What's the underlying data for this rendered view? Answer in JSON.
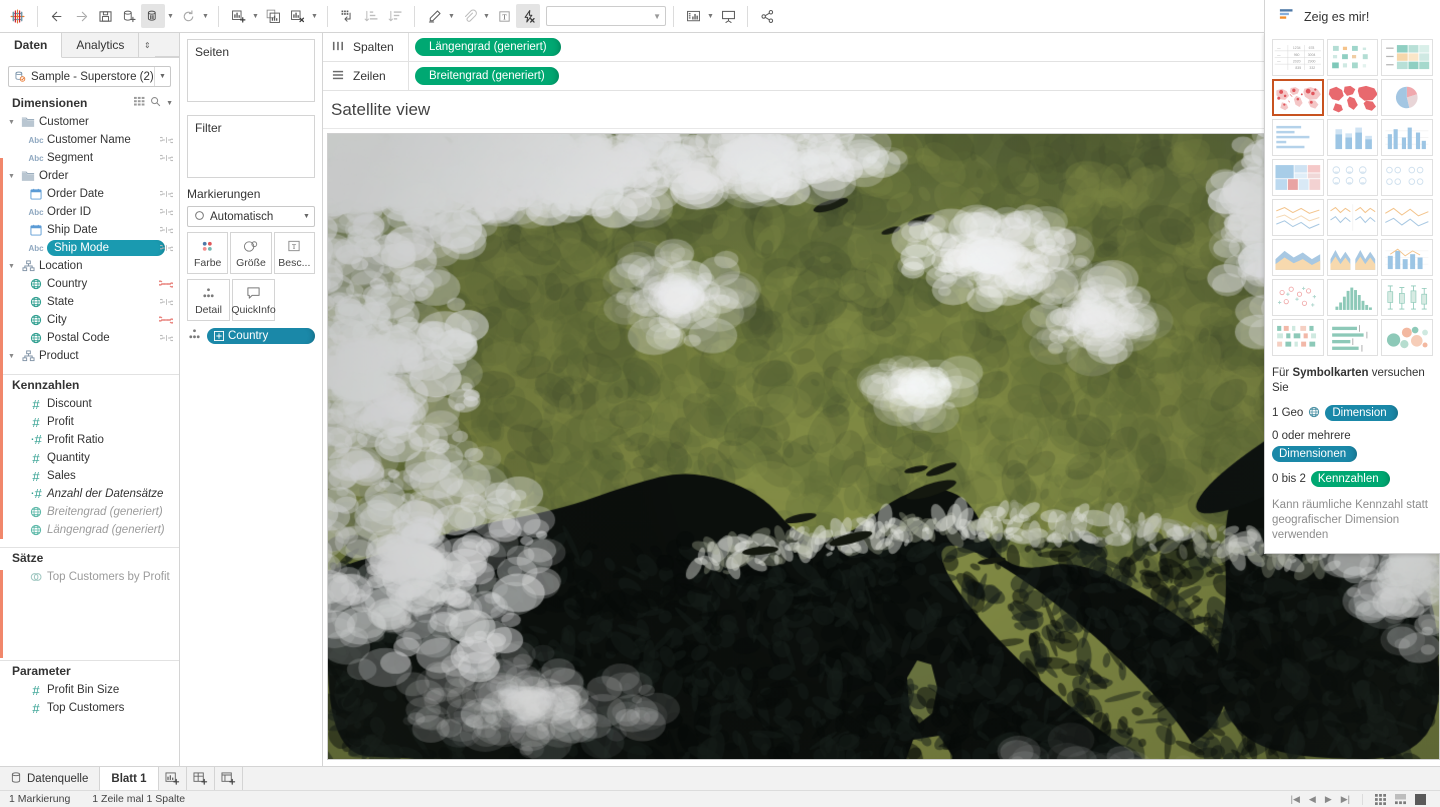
{
  "toolbar": {
    "logo_icon": "tableau-logo-icon",
    "buttons": [
      {
        "name": "back-button",
        "icon": "arrow-left-icon"
      },
      {
        "name": "forward-button",
        "icon": "arrow-right-icon"
      },
      {
        "name": "save-button",
        "icon": "save-icon"
      },
      {
        "name": "new-data-source-button",
        "icon": "database-plus-icon"
      },
      {
        "name": "pause-auto-update-button",
        "icon": "database-pause-icon"
      },
      {
        "name": "refresh-button",
        "icon": "refresh-icon"
      },
      {
        "name": "new-worksheet-button",
        "icon": "chart-plus-icon"
      },
      {
        "name": "duplicate-sheet-button",
        "icon": "chart-duplicate-icon"
      },
      {
        "name": "clear-sheet-button",
        "icon": "chart-clear-icon"
      },
      {
        "name": "swap-rows-columns-button",
        "icon": "swap-axes-icon"
      },
      {
        "name": "sort-ascending-button",
        "icon": "sort-asc-icon"
      },
      {
        "name": "sort-descending-button",
        "icon": "sort-desc-icon"
      },
      {
        "name": "highlight-button",
        "icon": "highlighter-icon"
      },
      {
        "name": "group-members-button",
        "icon": "paperclip-icon"
      },
      {
        "name": "show-mark-labels-button",
        "icon": "text-label-icon"
      },
      {
        "name": "fix-axes-button",
        "icon": "magic-clear-icon"
      },
      {
        "name": "presentation-size-button",
        "icon": "fit-size-icon"
      },
      {
        "name": "presentation-mode-button",
        "icon": "presentation-icon"
      },
      {
        "name": "share-button",
        "icon": "share-icon"
      }
    ],
    "fit_combo_value": "",
    "show_me_label": "Zeig es mir!",
    "show_me_icon": "show-me-icon"
  },
  "datapane": {
    "tabs": [
      {
        "label": "Daten",
        "selected": true
      },
      {
        "label": "Analytics",
        "selected": false
      }
    ],
    "datasource": {
      "name": "Sample - Superstore (2)",
      "icon": "datasource-icon",
      "caret": "chevron-down-icon"
    },
    "dimensions": {
      "header": "Dimensionen",
      "tools": [
        "grid-view-icon",
        "search-icon",
        "chevron-down-icon"
      ],
      "items": [
        {
          "label": "Customer",
          "icon": "folder-icon",
          "level": 0,
          "twist": "expanded"
        },
        {
          "label": "Customer Name",
          "icon": "abc-icon",
          "level": 1,
          "right": "link-icon"
        },
        {
          "label": "Segment",
          "icon": "abc-icon",
          "level": 1,
          "right": "link-icon"
        },
        {
          "label": "Order",
          "icon": "folder-icon",
          "level": 0,
          "twist": "expanded"
        },
        {
          "label": "Order Date",
          "icon": "calendar-icon",
          "level": 1,
          "right": "link-icon"
        },
        {
          "label": "Order ID",
          "icon": "abc-icon",
          "level": 1,
          "right": "link-icon"
        },
        {
          "label": "Ship Date",
          "icon": "calendar-icon",
          "level": 1,
          "right": "link-icon"
        },
        {
          "label": "Ship Mode",
          "icon": "abc-icon",
          "level": 1,
          "right": "link-icon",
          "selected": true
        },
        {
          "label": "Location",
          "icon": "hierarchy-icon",
          "level": 0,
          "twist": "expanded"
        },
        {
          "label": "Country",
          "icon": "globe-icon",
          "level": 1,
          "right": "link-active-icon"
        },
        {
          "label": "State",
          "icon": "globe-icon",
          "level": 1,
          "right": "link-icon"
        },
        {
          "label": "City",
          "icon": "globe-icon",
          "level": 1,
          "right": "link-active-icon"
        },
        {
          "label": "Postal Code",
          "icon": "globe-icon",
          "level": 1,
          "right": "link-icon"
        },
        {
          "label": "Product",
          "icon": "hierarchy-icon",
          "level": 0,
          "twist": "expanded"
        }
      ]
    },
    "measures": {
      "header": "Kennzahlen",
      "items": [
        {
          "label": "Discount",
          "icon": "hash-icon"
        },
        {
          "label": "Profit",
          "icon": "hash-icon"
        },
        {
          "label": "Profit Ratio",
          "icon": "hash-calc-icon"
        },
        {
          "label": "Quantity",
          "icon": "hash-icon"
        },
        {
          "label": "Sales",
          "icon": "hash-icon"
        },
        {
          "label": "Anzahl der Datensätze",
          "icon": "hash-calc-icon",
          "italic": true
        },
        {
          "label": "Breitengrad (generiert)",
          "icon": "globe-icon",
          "italic": true,
          "muted": true
        },
        {
          "label": "Längengrad (generiert)",
          "icon": "globe-icon",
          "italic": true,
          "muted": true
        }
      ]
    },
    "sets": {
      "header": "Sätze",
      "items": [
        {
          "label": "Top Customers by Profit",
          "icon": "set-icon",
          "muted": true
        }
      ]
    },
    "parameters": {
      "header": "Parameter",
      "items": [
        {
          "label": "Profit Bin Size",
          "icon": "hash-icon"
        },
        {
          "label": "Top Customers",
          "icon": "hash-icon"
        }
      ]
    }
  },
  "shelfcol": {
    "pages": {
      "title": "Seiten"
    },
    "filters": {
      "title": "Filter"
    },
    "marks": {
      "title": "Markierungen",
      "mark_type": "Automatisch",
      "mark_type_icon": "circle-icon",
      "buttons": [
        {
          "label": "Farbe",
          "icon": "color-icon"
        },
        {
          "label": "Größe",
          "icon": "size-icon"
        },
        {
          "label": "Besc...",
          "icon": "label-icon"
        },
        {
          "label": "Detail",
          "icon": "detail-icon"
        },
        {
          "label": "QuickInfo",
          "icon": "tooltip-icon"
        }
      ],
      "pills": [
        {
          "label": "Country",
          "icon": "detail-icon",
          "pill_icon": "plus-box-icon",
          "color": "blue"
        }
      ]
    }
  },
  "view": {
    "columns_shelf": {
      "label": "Spalten",
      "icon": "columns-icon",
      "pills": [
        "Längengrad (generiert)"
      ]
    },
    "rows_shelf": {
      "label": "Zeilen",
      "icon": "rows-icon",
      "pills": [
        "Breitengrad (generiert)"
      ]
    },
    "sheet_title": "Satellite view",
    "map_background": "satellite-imagery-europe"
  },
  "show_me": {
    "thumbnails": [
      {
        "name": "text-table",
        "type": "table"
      },
      {
        "name": "heat-map",
        "type": "heatmap"
      },
      {
        "name": "highlight-table",
        "type": "highlight-table"
      },
      {
        "name": "symbol-map",
        "type": "symbol-map",
        "selected": true
      },
      {
        "name": "filled-map",
        "type": "filled-map"
      },
      {
        "name": "pie-chart",
        "type": "pie"
      },
      {
        "name": "horizontal-bars",
        "type": "hbar"
      },
      {
        "name": "stacked-bars",
        "type": "stacked-bar"
      },
      {
        "name": "side-by-side-bars",
        "type": "grouped-bar"
      },
      {
        "name": "treemap",
        "type": "treemap"
      },
      {
        "name": "circle-views",
        "type": "circle-view"
      },
      {
        "name": "side-by-side-circles",
        "type": "side-circle"
      },
      {
        "name": "continuous-lines",
        "type": "line"
      },
      {
        "name": "dual-lines",
        "type": "dual-line"
      },
      {
        "name": "discrete-lines",
        "type": "discrete-line"
      },
      {
        "name": "area-charts-continuous",
        "type": "area"
      },
      {
        "name": "area-charts-discrete",
        "type": "area-discrete"
      },
      {
        "name": "dual-combination",
        "type": "dual-combo"
      },
      {
        "name": "scatter-plot",
        "type": "scatter"
      },
      {
        "name": "histogram",
        "type": "histogram"
      },
      {
        "name": "box-and-whisker",
        "type": "boxplot"
      },
      {
        "name": "gantt-chart",
        "type": "gantt"
      },
      {
        "name": "bullet-graph",
        "type": "bullet"
      },
      {
        "name": "packed-bubbles",
        "type": "bubble"
      }
    ],
    "hint_prefix": "Für ",
    "hint_bold": "Symbolkarten",
    "hint_suffix": " versuchen Sie",
    "requirements": [
      {
        "prefix": "1 Geo",
        "icon": "globe-icon",
        "pill": "Dimension",
        "pill_color": "blue"
      },
      {
        "prefix": "0 oder mehrere",
        "pill": "Dimensionen",
        "pill_color": "blue",
        "wrap": true
      },
      {
        "prefix": "0 bis 2",
        "pill": "Kennzahlen",
        "pill_color": "green"
      }
    ],
    "note": "Kann räumliche Kennzahl statt geografischer Dimension verwenden"
  },
  "bottom": {
    "tabs": [
      {
        "label": "Datenquelle",
        "icon": "datasource-tab-icon",
        "selected": false
      },
      {
        "label": "Blatt 1",
        "icon": "",
        "selected": true
      }
    ],
    "new_buttons": [
      {
        "name": "new-worksheet-tab-button",
        "icon": "new-sheet-icon"
      },
      {
        "name": "new-dashboard-tab-button",
        "icon": "new-dashboard-icon"
      },
      {
        "name": "new-story-tab-button",
        "icon": "new-story-icon"
      }
    ],
    "status": {
      "marks": "1 Markierung",
      "dimensions": "1 Zeile mal 1 Spalte"
    },
    "nav_buttons": [
      "first-icon",
      "previous-icon",
      "next-icon",
      "last-icon"
    ],
    "view_buttons": [
      "grid-view-icon",
      "list-view-icon",
      "fill-view-icon"
    ]
  },
  "colors": {
    "pill_green": "#00a872",
    "pill_blue": "#1a88a8",
    "selection_orange": "#c8521f",
    "accent_teal": "#1a9ab0"
  }
}
